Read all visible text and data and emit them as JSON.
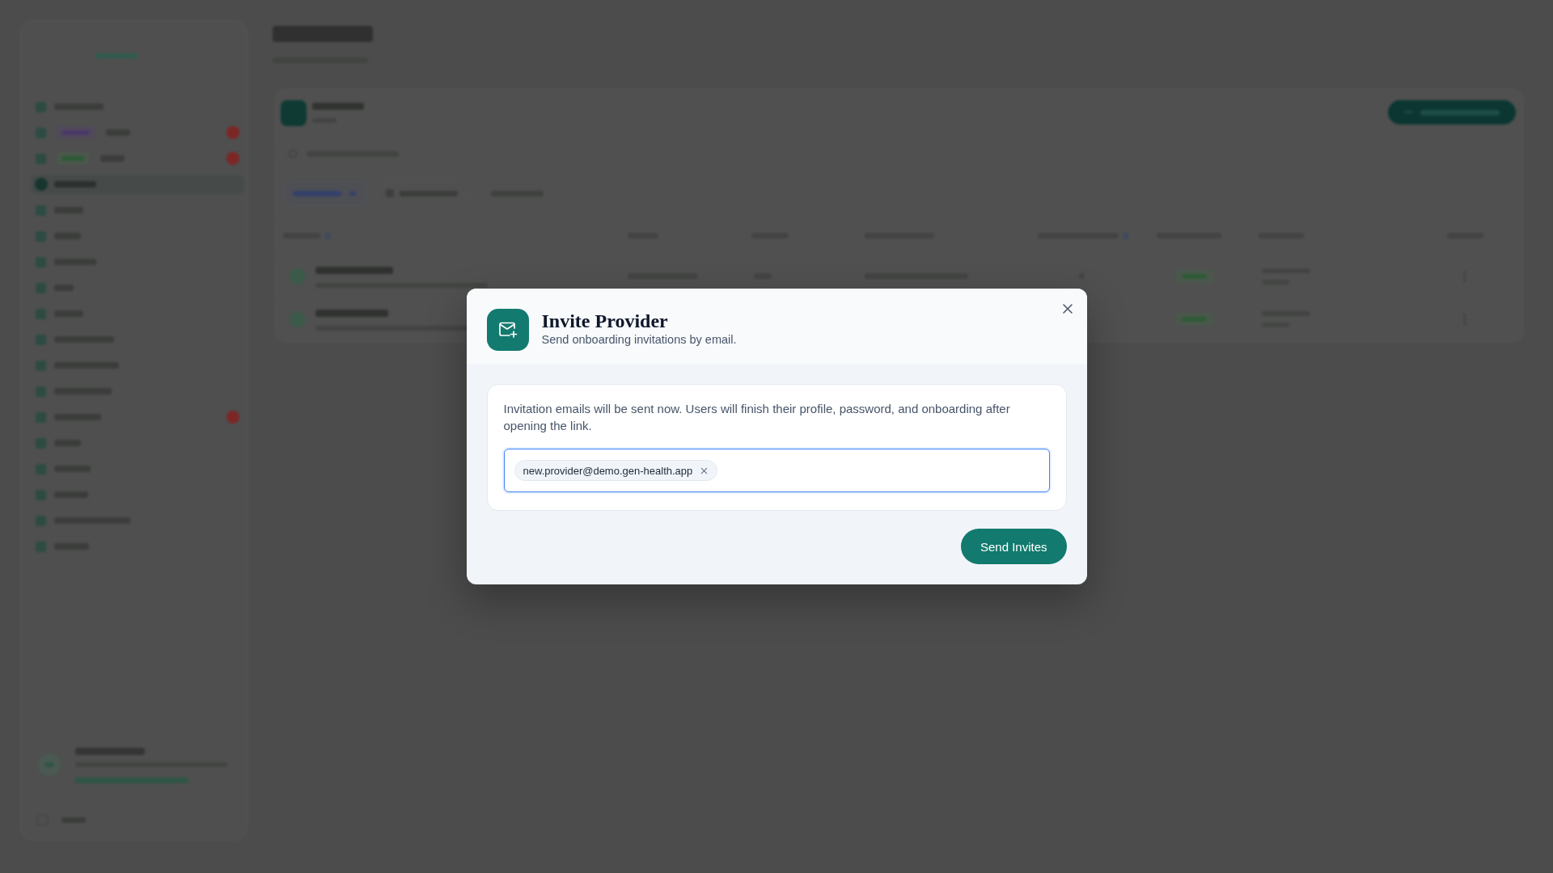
{
  "invite_dialog": {
    "title": "Invite Provider",
    "subtitle": "Send onboarding invitations by email.",
    "message": "Invitation emails will be sent now. Users will finish their profile, password, and onboarding after opening the link.",
    "email_field": {
      "focused": true,
      "recipients": [
        "new.provider@demo.gen-health.app"
      ]
    },
    "submit_button": "Send Invites"
  }
}
